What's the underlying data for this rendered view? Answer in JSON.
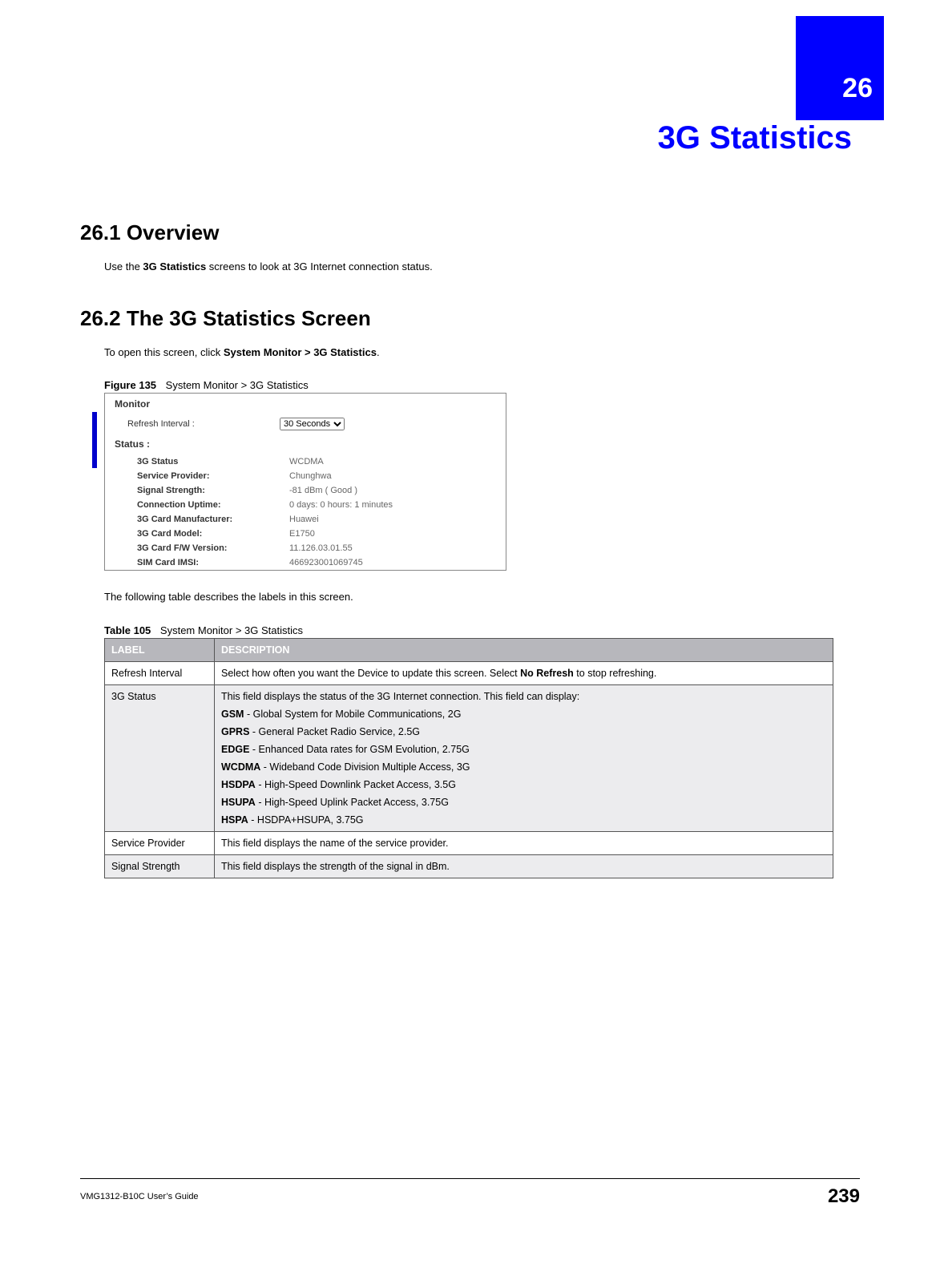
{
  "chapterNumber": "26",
  "chapterTitle": "3G Statistics",
  "section1": {
    "heading": "26.1  Overview",
    "prefix": "Use the ",
    "bold": "3G Statistics",
    "suffix": " screens to look at 3G Internet connection status."
  },
  "section2": {
    "heading": "26.2  The 3G Statistics Screen",
    "prefix": "To open this screen, click ",
    "bold": "System Monitor > 3G Statistics",
    "suffix": "."
  },
  "figure": {
    "label": "Figure 135",
    "caption": "System Monitor > 3G Statistics"
  },
  "screenshot": {
    "monitorHeading": "Monitor",
    "refreshLabel": "Refresh Interval :",
    "refreshValue": "30 Seconds",
    "statusHeading": "Status :",
    "rows": [
      {
        "label": "3G Status",
        "value": "WCDMA"
      },
      {
        "label": "Service Provider:",
        "value": "Chunghwa"
      },
      {
        "label": "Signal Strength:",
        "value": "-81 dBm ( Good )"
      },
      {
        "label": "Connection Uptime:",
        "value": "0 days: 0 hours: 1 minutes"
      },
      {
        "label": "3G Card Manufacturer:",
        "value": "Huawei"
      },
      {
        "label": "3G Card Model:",
        "value": "E1750"
      },
      {
        "label": "3G Card F/W Version:",
        "value": "11.126.03.01.55"
      },
      {
        "label": "SIM Card IMSI:",
        "value": "466923001069745"
      }
    ]
  },
  "midText": "The following table describes the labels in this screen.",
  "table": {
    "label": "Table 105",
    "caption": "System Monitor > 3G Statistics",
    "headers": [
      "LABEL",
      "DESCRIPTION"
    ],
    "rows": [
      {
        "label": "Refresh Interval",
        "desc_prefix": "Select how often you want the Device to update this screen. Select ",
        "desc_bold": "No Refresh",
        "desc_suffix": " to stop refreshing."
      },
      {
        "label": "3G Status",
        "intro": "This field displays the status of the 3G Internet connection. This field can display:",
        "lines": [
          {
            "b": "GSM",
            "t": " - Global System for Mobile Communications, 2G"
          },
          {
            "b": "GPRS",
            "t": " - General Packet Radio Service, 2.5G"
          },
          {
            "b": "EDGE",
            "t": " - Enhanced Data rates for GSM Evolution, 2.75G"
          },
          {
            "b": "WCDMA",
            "t": " - Wideband Code Division Multiple Access, 3G"
          },
          {
            "b": "HSDPA",
            "t": " - High-Speed Downlink Packet Access, 3.5G"
          },
          {
            "b": "HSUPA",
            "t": " - High-Speed Uplink Packet Access, 3.75G"
          },
          {
            "b": "HSPA",
            "t": " - HSDPA+HSUPA, 3.75G"
          }
        ]
      },
      {
        "label": "Service Provider",
        "desc": "This field displays the name of the service provider."
      },
      {
        "label": "Signal Strength",
        "desc": "This field displays the strength of the signal in dBm."
      }
    ]
  },
  "footer": {
    "guide": "VMG1312-B10C User’s Guide",
    "page": "239"
  }
}
